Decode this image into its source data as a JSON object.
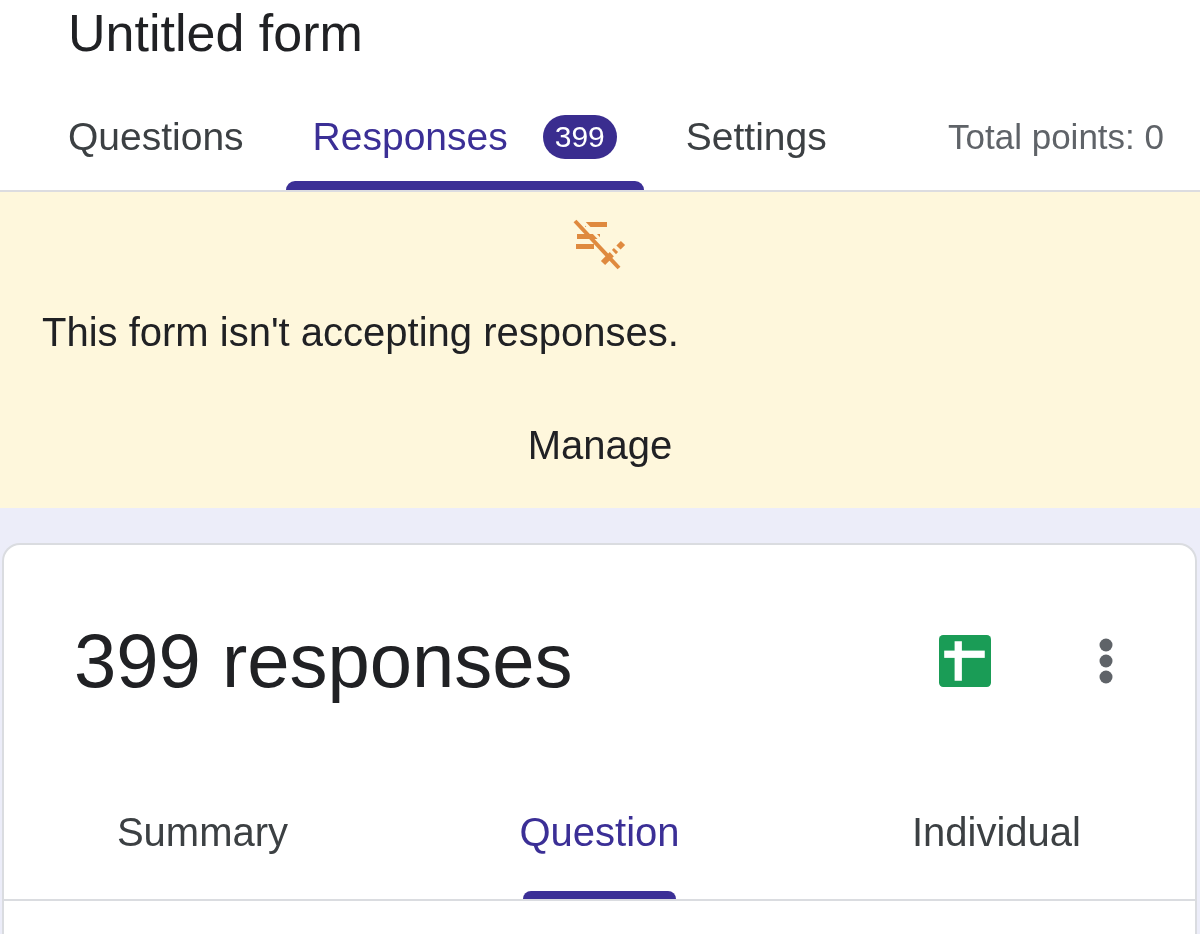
{
  "form": {
    "title": "Untitled form"
  },
  "tabs": [
    {
      "label": "Questions",
      "selected": false
    },
    {
      "label": "Responses",
      "selected": true,
      "badge": "399"
    },
    {
      "label": "Settings",
      "selected": false
    }
  ],
  "total_points": "Total points: 0",
  "banner": {
    "message": "This form isn't accepting responses.",
    "action": "Manage"
  },
  "responses_card": {
    "heading": "399 responses",
    "subtabs": [
      {
        "label": "Summary",
        "selected": false
      },
      {
        "label": "Question",
        "selected": true
      },
      {
        "label": "Individual",
        "selected": false
      }
    ]
  }
}
